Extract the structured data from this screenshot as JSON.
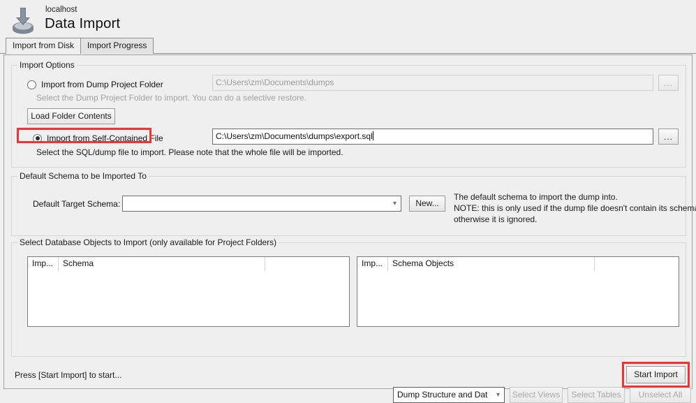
{
  "header": {
    "host": "localhost",
    "title": "Data Import",
    "icon": "data-import-icon"
  },
  "tabs": [
    {
      "label": "Import from Disk",
      "active": true
    },
    {
      "label": "Import Progress",
      "active": false
    }
  ],
  "colors": {
    "highlight": "#f5322f",
    "window_bg": "#efefef",
    "field_bg": "#ffffff",
    "disabled_text": "#a2a2a2"
  },
  "import_options": {
    "group_title": "Import Options",
    "dump_folder": {
      "radio_label": "Import from Dump Project Folder",
      "checked": false,
      "path_value": "C:\\Users\\zm\\Documents\\dumps",
      "path_enabled": false,
      "browse_label": "...",
      "hint": "Select the Dump Project Folder to import. You can do a selective restore.",
      "load_button_label": "Load Folder Contents"
    },
    "self_contained": {
      "radio_label": "Import from Self-Contained File",
      "checked": true,
      "highlighted": true,
      "path_value": "C:\\Users\\zm\\Documents\\dumps\\export.sql",
      "path_enabled": true,
      "browse_label": "...",
      "hint": "Select the SQL/dump file to import. Please note that the whole file will be imported."
    }
  },
  "default_schema": {
    "group_title": "Default Schema to be Imported To",
    "field_label": "Default Target Schema:",
    "selected_value": "",
    "new_button_label": "New...",
    "note_line1": "The default schema to import the dump into.",
    "note_line2": "NOTE: this is only used if the dump file doesn't contain its schema,",
    "note_line3": "otherwise it is ignored."
  },
  "db_objects": {
    "group_title": "Select Database Objects to Import (only available for Project Folders)",
    "schema_list": {
      "columns": [
        "Imp...",
        "Schema",
        ""
      ],
      "rows": []
    },
    "objects_list": {
      "columns": [
        "Imp...",
        "Schema Objects",
        ""
      ],
      "rows": []
    },
    "dump_type_value": "Dump Structure and Dat",
    "buttons": [
      {
        "label": "Select Views",
        "enabled": false
      },
      {
        "label": "Select Tables",
        "enabled": false
      },
      {
        "label": "Unselect All",
        "enabled": false
      }
    ]
  },
  "footer": {
    "status": "Press [Start Import] to start...",
    "start_button_label": "Start Import",
    "start_button_highlighted": true
  }
}
